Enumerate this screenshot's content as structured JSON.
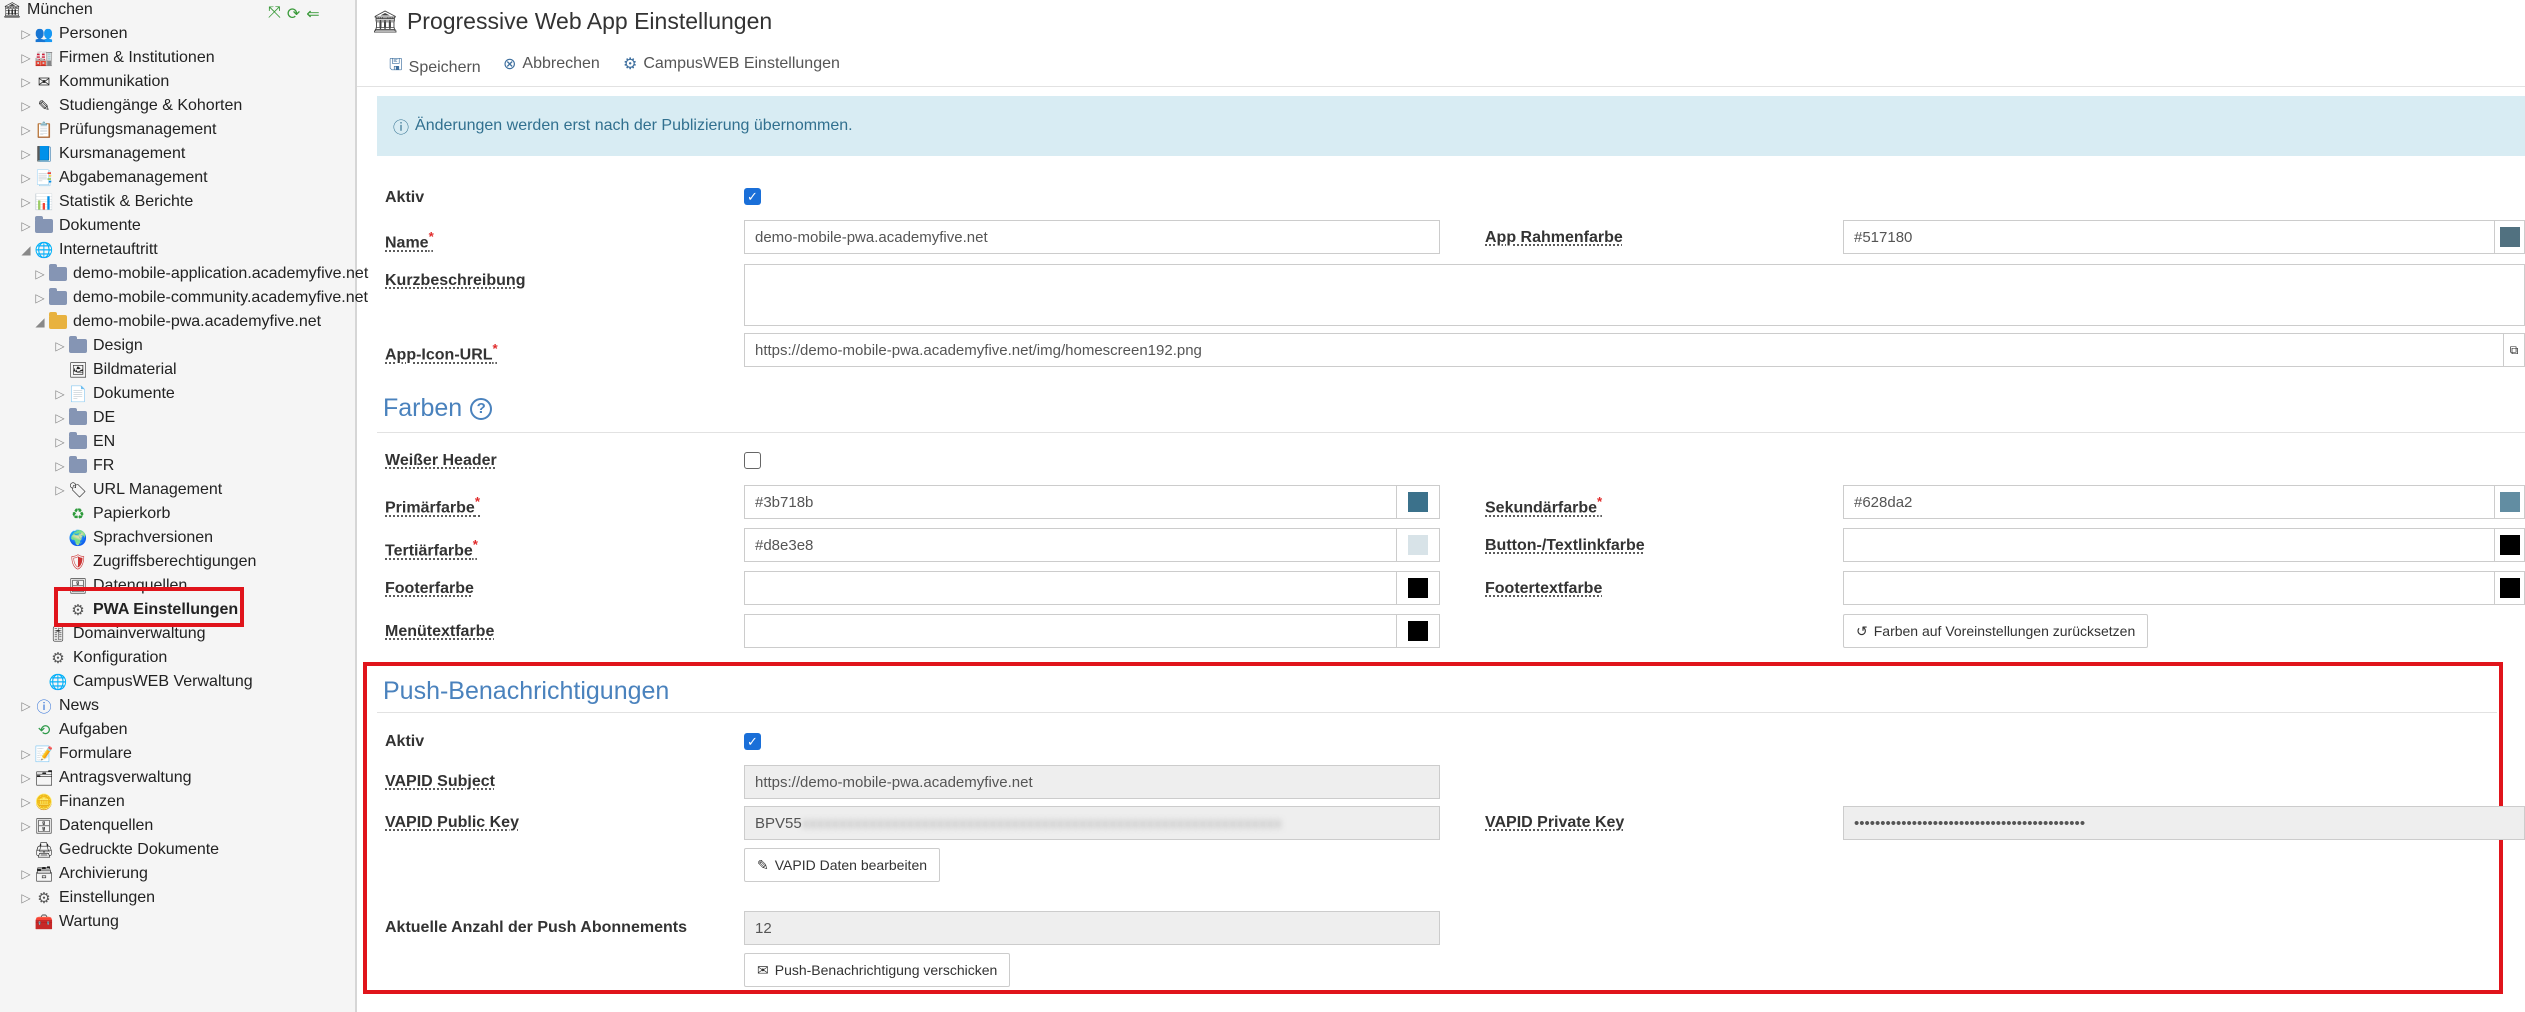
{
  "sidebar": {
    "tree": [
      {
        "label": "München",
        "level": 0,
        "icon": "institution-icon",
        "tw": ""
      },
      {
        "label": "Personen",
        "level": 1,
        "icon": "persons-icon",
        "tw": "▷"
      },
      {
        "label": "Firmen & Institutionen",
        "level": 1,
        "icon": "company-icon",
        "tw": "▷"
      },
      {
        "label": "Kommunikation",
        "level": 1,
        "icon": "envelope-icon",
        "tw": "▷"
      },
      {
        "label": "Studiengänge & Kohorten",
        "level": 1,
        "icon": "graduation-icon",
        "tw": "▷"
      },
      {
        "label": "Prüfungsmanagement",
        "level": 1,
        "icon": "exam-icon",
        "tw": "▷"
      },
      {
        "label": "Kursmanagement",
        "level": 1,
        "icon": "book-icon",
        "tw": "▷"
      },
      {
        "label": "Abgabemanagement",
        "level": 1,
        "icon": "submission-icon",
        "tw": "▷"
      },
      {
        "label": "Statistik & Berichte",
        "level": 1,
        "icon": "bar-chart-icon",
        "tw": "▷"
      },
      {
        "label": "Dokumente",
        "level": 1,
        "icon": "folder-icon",
        "tw": "▷"
      },
      {
        "label": "Internetauftritt",
        "level": 1,
        "icon": "globe-icon",
        "tw": "◢"
      },
      {
        "label": "demo-mobile-application.academyfive.net",
        "level": 2,
        "icon": "folder-icon",
        "tw": "▷"
      },
      {
        "label": "demo-mobile-community.academyfive.net",
        "level": 2,
        "icon": "folder-icon",
        "tw": "▷"
      },
      {
        "label": "demo-mobile-pwa.academyfive.net",
        "level": 2,
        "icon": "folder-open-icon",
        "tw": "◢"
      },
      {
        "label": "Design",
        "level": 3,
        "icon": "folder-icon",
        "tw": "▷"
      },
      {
        "label": "Bildmaterial",
        "level": 3,
        "icon": "image-icon",
        "tw": ""
      },
      {
        "label": "Dokumente",
        "level": 3,
        "icon": "document-icon",
        "tw": "▷"
      },
      {
        "label": "DE",
        "level": 3,
        "icon": "folder-icon",
        "tw": "▷"
      },
      {
        "label": "EN",
        "level": 3,
        "icon": "folder-icon",
        "tw": "▷"
      },
      {
        "label": "FR",
        "level": 3,
        "icon": "folder-icon",
        "tw": "▷"
      },
      {
        "label": "URL Management",
        "level": 3,
        "icon": "tag-icon",
        "tw": "▷"
      },
      {
        "label": "Papierkorb",
        "level": 3,
        "icon": "recycle-icon",
        "tw": ""
      },
      {
        "label": "Sprachversionen",
        "level": 3,
        "icon": "languages-icon",
        "tw": ""
      },
      {
        "label": "Zugriffsberechtigungen",
        "level": 3,
        "icon": "shield-icon",
        "tw": ""
      },
      {
        "label": "Datenquellen",
        "level": 3,
        "icon": "database-icon",
        "tw": ""
      },
      {
        "label": "PWA Einstellungen",
        "level": 3,
        "icon": "gear-icon",
        "tw": "",
        "selected": true
      },
      {
        "label": "Domainverwaltung",
        "level": 2,
        "icon": "sliders-icon",
        "tw": ""
      },
      {
        "label": "Konfiguration",
        "level": 2,
        "icon": "gear-icon",
        "tw": ""
      },
      {
        "label": "CampusWEB Verwaltung",
        "level": 2,
        "icon": "campusweb-icon",
        "tw": ""
      },
      {
        "label": "News",
        "level": 1,
        "icon": "info-icon",
        "tw": "▷"
      },
      {
        "label": "Aufgaben",
        "level": 1,
        "icon": "history-icon",
        "tw": ""
      },
      {
        "label": "Formulare",
        "level": 1,
        "icon": "form-icon",
        "tw": "▷"
      },
      {
        "label": "Antragsverwaltung",
        "level": 1,
        "icon": "application-icon",
        "tw": "▷"
      },
      {
        "label": "Finanzen",
        "level": 1,
        "icon": "coins-icon",
        "tw": "▷"
      },
      {
        "label": "Datenquellen",
        "level": 1,
        "icon": "database-icon",
        "tw": "▷"
      },
      {
        "label": "Gedruckte Dokumente",
        "level": 1,
        "icon": "printed-docs-icon",
        "tw": ""
      },
      {
        "label": "Archivierung",
        "level": 1,
        "icon": "archive-icon",
        "tw": "▷"
      },
      {
        "label": "Einstellungen",
        "level": 1,
        "icon": "gear-icon",
        "tw": "▷"
      },
      {
        "label": "Wartung",
        "level": 1,
        "icon": "toolbox-icon",
        "tw": ""
      }
    ]
  },
  "header": {
    "title": "Progressive Web App Einstellungen"
  },
  "toolbar": {
    "save": "Speichern",
    "cancel": "Abbrechen",
    "campusweb": "CampusWEB Einstellungen"
  },
  "info": "Änderungen werden erst nach der Publizierung übernommen.",
  "form": {
    "aktiv_label": "Aktiv",
    "aktiv_checked": true,
    "name_label": "Name",
    "name_value": "demo-mobile-pwa.academyfive.net",
    "rahmen_label": "App Rahmenfarbe",
    "rahmen_value": "#517180",
    "kurz_label": "Kurzbeschreibung",
    "kurz_value": "",
    "icon_url_label": "App-Icon-URL",
    "icon_url_value": "https://demo-mobile-pwa.academyfive.net/img/homescreen192.png",
    "required_mark": "*"
  },
  "colors": {
    "section_title": "Farben",
    "help_icon": "?",
    "white_header_label": "Weißer Header",
    "white_header_checked": false,
    "primary_label": "Primärfarbe",
    "primary_value": "#3b718b",
    "secondary_label": "Sekundärfarbe",
    "secondary_value": "#628da2",
    "tertiary_label": "Tertiärfarbe",
    "tertiary_value": "#d8e3e8",
    "button_label": "Button-/Textlinkfarbe",
    "button_value": "",
    "footer_label": "Footerfarbe",
    "footer_value": "",
    "footer_text_label": "Footertextfarbe",
    "footer_text_value": "",
    "menu_text_label": "Menütextfarbe",
    "menu_text_value": "",
    "reset_button": "Farben auf Voreinstellungen zurücksetzen",
    "swatches": {
      "rahmen": "#517180",
      "primary": "#3b718b",
      "secondary": "#628da2",
      "tertiary": "#d8e3e8",
      "button": "#000000",
      "footer": "#000000",
      "footer_text": "#000000",
      "menu_text": "#000000"
    }
  },
  "push": {
    "section_title": "Push-Benachrichtigungen",
    "aktiv_label": "Aktiv",
    "aktiv_checked": true,
    "subject_label": "VAPID Subject",
    "subject_value": "https://demo-mobile-pwa.academyfive.net",
    "public_key_label": "VAPID Public Key",
    "public_key_prefix": "BPV55",
    "public_key_hidden": "xxxxxxxxxxxxxxxxxxxxxxxxxxxxxxxxxxxxxxxxxxxxxxxxxxxxxxxxxxxxxxxx",
    "private_key_label": "VAPID Private Key",
    "private_key_value": "••••••••••••••••••••••••••••••••••••••••••••",
    "edit_vapid_button": "VAPID Daten bearbeiten",
    "count_label": "Aktuelle Anzahl der Push Abonnements",
    "count_value": "12",
    "send_button": "Push-Benachrichtigung verschicken"
  }
}
